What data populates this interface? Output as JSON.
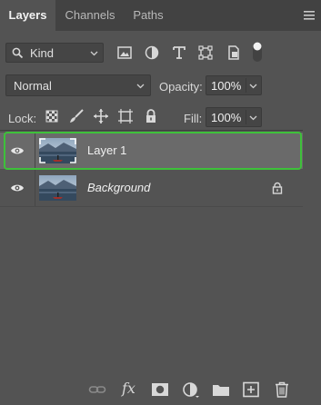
{
  "tabs": [
    {
      "label": "Layers",
      "active": true
    },
    {
      "label": "Channels",
      "active": false
    },
    {
      "label": "Paths",
      "active": false
    }
  ],
  "filter": {
    "kind_label": "Kind",
    "icons": [
      "image-filter-icon",
      "adjustment-filter-icon",
      "type-filter-icon",
      "shape-filter-icon",
      "smart-object-filter-icon",
      "filter-toggle-icon"
    ]
  },
  "blend": {
    "mode": "Normal",
    "opacity_label": "Opacity:",
    "opacity_value": "100%"
  },
  "lock": {
    "label": "Lock:",
    "icons": [
      "lock-transparent-pixels-icon",
      "lock-image-pixels-icon",
      "lock-position-icon",
      "lock-artboard-icon",
      "lock-all-icon"
    ],
    "fill_label": "Fill:",
    "fill_value": "100%"
  },
  "layers": [
    {
      "name": "Layer 1",
      "selected": true,
      "visible": true,
      "locked": false,
      "italic": false
    },
    {
      "name": "Background",
      "selected": false,
      "visible": true,
      "locked": true,
      "italic": true
    }
  ],
  "bottom_toolbar": {
    "fx_label": "fx",
    "icons": [
      "link-layers-icon",
      "add-layer-style-icon",
      "add-mask-icon",
      "new-adjustment-layer-icon",
      "new-group-icon",
      "new-layer-icon",
      "delete-layer-icon"
    ]
  },
  "colors": {
    "panel_bg": "#535353",
    "tabbar_bg": "#424242",
    "selected_row_bg": "#6a6a6a",
    "selection_outline": "#3ec13a"
  }
}
